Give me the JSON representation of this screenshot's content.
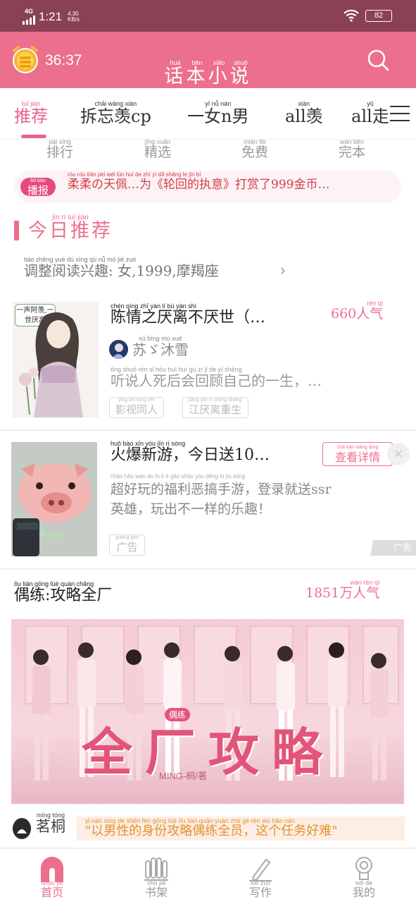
{
  "status_bar": {
    "network": "4G",
    "time": "1:21",
    "speed_value": "4.30",
    "speed_unit": "KB/s",
    "battery": "82"
  },
  "header": {
    "timer": "36:37",
    "title_ruby": [
      "huà",
      "běn",
      "xiǎo",
      "shuō"
    ],
    "title_chars": [
      "话",
      "本",
      "小",
      "说"
    ]
  },
  "tabs": [
    {
      "label": "推荐",
      "ruby": "tuī jiàn"
    },
    {
      "label": "拆忘羡cp",
      "ruby": "chāi wàng xiàn"
    },
    {
      "label": "一女n男",
      "ruby": "yī nǚ nán"
    },
    {
      "label": "all羡",
      "ruby": "xiàn"
    },
    {
      "label": "all走",
      "ruby": "yǔ"
    }
  ],
  "subnav": [
    {
      "label": "排行",
      "ruby": "pái xíng"
    },
    {
      "label": "精选",
      "ruby": "jīng xuǎn"
    },
    {
      "label": "免费",
      "ruby": "miǎn fèi"
    },
    {
      "label": "完本",
      "ruby": "wán běn"
    }
  ],
  "notice": {
    "badge": "播报",
    "badge_ruby": "bō bào",
    "text": "柔柔の天佩…为《轮回的执意》打赏了999金币…",
    "text_ruby": "róu róu tiān pèi wéi lún huí de zhí yì dǎ shǎng le jīn bì"
  },
  "section": {
    "title": "今日推荐",
    "ruby": "jīn rì tuī jiàn"
  },
  "preference": {
    "text": "调整阅读兴趣: 女,1999,摩羯座",
    "ruby": "tiáo zhěng yuè dú xìng qù nǚ mó jié zuò"
  },
  "book1": {
    "cover_tag": "一声阿羡,一世厌离",
    "title": "陈情之厌离不厌世（…",
    "title_ruby": "chén qíng zhī yàn lí bù yàn shì",
    "popularity": "660人气",
    "pop_ruby": "rén qì",
    "author": "苏ゞ沐雪",
    "author_ruby": "sū bīng mù xuě",
    "desc": "听说人死后会回顾自己的一生，…",
    "desc_ruby": "tīng shuō rén sǐ hòu huì huí gù zì jǐ de yī shēng",
    "tags": [
      "影视同人",
      "江厌离重生"
    ],
    "tags_ruby": [
      "yǐng shì tóng rén",
      "jiāng yàn lí chóng shēng"
    ]
  },
  "ad": {
    "cover_caption": "嘿 Siri",
    "title": "火爆新游，今日送10…",
    "title_ruby": "huǒ bào xīn yóu jīn rì sòng",
    "button": "查看详情",
    "button_ruby": "chá kàn xiáng qíng",
    "close": "×",
    "desc_lines": [
      "超好玩的福利恶搞手游，登录就送ssr",
      "英雄，玩出不一样的乐趣！"
    ],
    "desc_ruby": "chāo hǎo wán de fú lì è gǎo shǒu yóu dēng lù jiù sòng",
    "tag": "广告",
    "tag_ruby": "guǎng gào",
    "mark": "广告"
  },
  "featured": {
    "title": "偶练:攻略全厂",
    "title_ruby": "ǒu liàn gōng lüè quán chǎng",
    "popularity": "1851万人气",
    "pop_ruby": "wàn rén qì",
    "banner_logo": "全厂攻略",
    "banner_badge": "偶练",
    "banner_author": "MING-桐/著",
    "author": "茗桐",
    "author_ruby": "míng tóng",
    "quote": "\"以男性的身份攻略偶练全员，这个任务好难\"",
    "quote_ruby": "yǐ nán xìng de shēn fèn gōng lüè ǒu liàn quán yuán zhè gè rèn wù hǎo nán"
  },
  "bottom_nav": [
    {
      "label": "首页",
      "ruby": "shǒu yè"
    },
    {
      "label": "书架",
      "ruby": "shū jià"
    },
    {
      "label": "写作",
      "ruby": "xiě zuò"
    },
    {
      "label": "我的",
      "ruby": "wǒ de"
    }
  ],
  "colors": {
    "accent": "#ec6f8d",
    "status_bar": "#8a4155",
    "notice_text": "#d43d4a",
    "quote_text": "#e2922f"
  },
  "icons": [
    "alarm-clock-icon",
    "search-icon",
    "menu-icon",
    "home-icon",
    "bookshelf-icon",
    "pen-icon",
    "profile-icon",
    "close-icon"
  ]
}
